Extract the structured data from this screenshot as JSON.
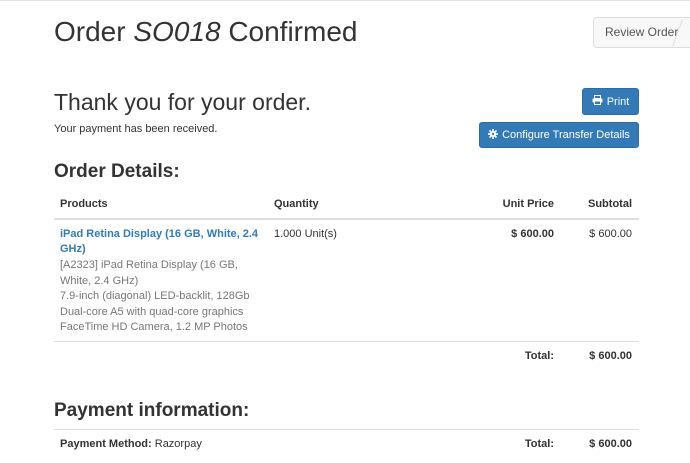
{
  "header": {
    "title_prefix": "Order",
    "order_number": "SO018",
    "title_suffix": "Confirmed",
    "review_button": "Review Order"
  },
  "confirmation": {
    "thanks": "Thank you for your order.",
    "received": "Your payment has been received.",
    "print_button": "Print",
    "print_icon": "print-icon",
    "transfer_button": "Configure Transfer Details",
    "transfer_icon": "gear-icon"
  },
  "order_details": {
    "heading": "Order Details:",
    "columns": {
      "products": "Products",
      "quantity": "Quantity",
      "unit_price": "Unit Price",
      "subtotal": "Subtotal"
    },
    "items": [
      {
        "name": "iPad Retina Display (16 GB, White, 2.4 GHz)",
        "description_lines": [
          "[A2323] iPad Retina Display (16 GB,",
          "White, 2.4 GHz)",
          "7.9‑inch (diagonal) LED‑backlit, 128Gb",
          "Dual‑core A5 with quad‑core graphics",
          "FaceTime HD Camera, 1.2 MP Photos"
        ],
        "quantity": "1.000 Unit(s)",
        "unit_price": "$ 600.00",
        "subtotal": "$ 600.00"
      }
    ],
    "total_label": "Total:",
    "total_value": "$ 600.00"
  },
  "payment": {
    "heading": "Payment information:",
    "method_label": "Payment Method:",
    "method_value": "Razorpay",
    "total_label": "Total:",
    "total_value": "$ 600.00"
  },
  "colors": {
    "primary": "#337ab7",
    "link": "#337ab7",
    "muted_text": "#777777"
  }
}
